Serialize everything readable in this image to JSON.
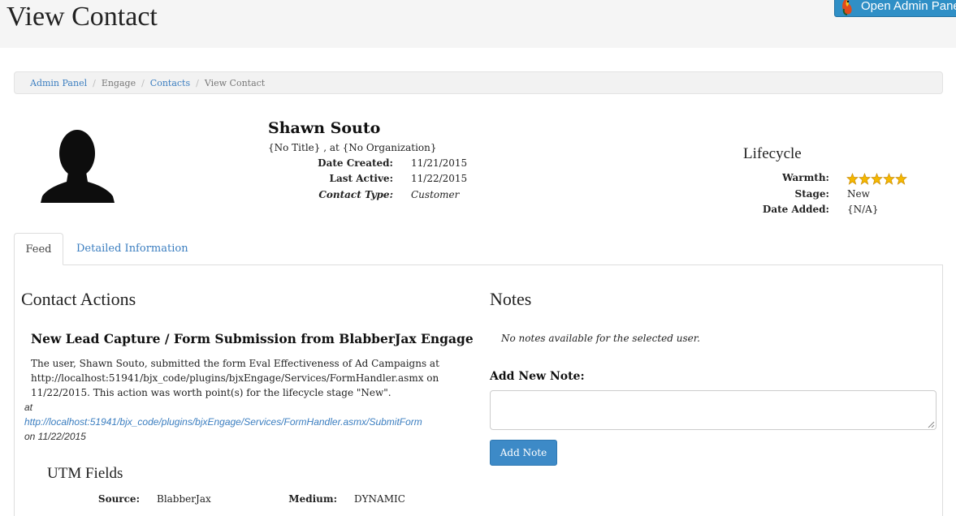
{
  "header": {
    "title": "View Contact",
    "admin_button_label": "Open Admin Panel"
  },
  "breadcrumb": {
    "items": [
      {
        "label": "Admin Panel",
        "link": true
      },
      {
        "label": "Engage",
        "link": false
      },
      {
        "label": "Contacts",
        "link": true
      },
      {
        "label": "View Contact",
        "link": false
      }
    ],
    "separator": "/"
  },
  "contact": {
    "name": "Shawn Souto",
    "subtitle": "{No Title} , at {No Organization}",
    "date_created_label": "Date Created:",
    "date_created": "11/21/2015",
    "last_active_label": "Last Active:",
    "last_active": "11/22/2015",
    "contact_type_label": "Contact Type:",
    "contact_type": "Customer"
  },
  "lifecycle": {
    "title": "Lifecycle",
    "warmth_label": "Warmth:",
    "warmth_stars": 5,
    "stage_label": "Stage:",
    "stage": "New",
    "date_added_label": "Date Added:",
    "date_added": "{N/A}"
  },
  "tabs": [
    {
      "label": "Feed",
      "active": true
    },
    {
      "label": "Detailed Information",
      "active": false
    }
  ],
  "contact_actions": {
    "title": "Contact Actions",
    "action_title": "New Lead Capture / Form Submission from BlabberJax Engage",
    "description": "The user, Shawn Souto, submitted the form Eval Effectiveness of Ad Campaigns at http://localhost:51941/bjx_code/plugins/bjxEngage/Services/FormHandler.asmx on 11/22/2015. This action was worth point(s) for the lifecycle stage \"New\".",
    "at_label": "at",
    "url": "http://localhost:51941/bjx_code/plugins/bjxEngage/Services/FormHandler.asmx/SubmitForm",
    "on_text": "on 11/22/2015"
  },
  "utm": {
    "title": "UTM Fields",
    "source_label": "Source:",
    "source": "BlabberJax",
    "medium_label": "Medium:",
    "medium": "DYNAMIC"
  },
  "notes": {
    "title": "Notes",
    "empty_text": "No notes available for the selected user.",
    "add_label": "Add New Note:",
    "input_value": "",
    "button_label": "Add Note"
  },
  "colors": {
    "link": "#3b7ec0",
    "button": "#3d8ac7",
    "admin_button": "#2f8fc6",
    "star": "#f5b800"
  }
}
